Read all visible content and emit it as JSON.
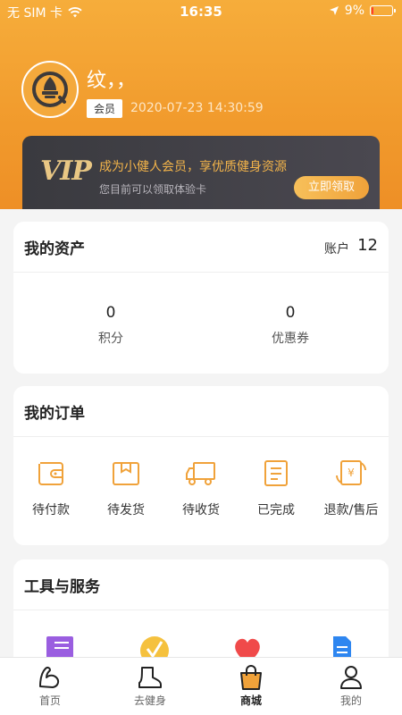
{
  "status_bar": {
    "carrier": "无 SIM 卡",
    "time": "16:35",
    "battery": "9%",
    "battery_level": 0.09
  },
  "profile": {
    "username": "纹，，",
    "member_badge": "会员",
    "login_time": "2020-07-23 14:30:59"
  },
  "vip": {
    "logo": "VIP",
    "title": "成为小健人会员，享优质健身资源",
    "subtitle": "您目前可以领取体验卡",
    "button": "立即领取"
  },
  "assets": {
    "title": "我的资产",
    "account_label": "账户",
    "account_value": "12",
    "items": [
      {
        "value": "0",
        "label": "积分"
      },
      {
        "value": "0",
        "label": "优惠券"
      }
    ]
  },
  "orders": {
    "title": "我的订单",
    "items": [
      {
        "label": "待付款",
        "icon": "wallet-icon"
      },
      {
        "label": "待发货",
        "icon": "package-icon"
      },
      {
        "label": "待收货",
        "icon": "truck-icon"
      },
      {
        "label": "已完成",
        "icon": "document-icon"
      },
      {
        "label": "退款/售后",
        "icon": "refund-icon"
      }
    ]
  },
  "tools": {
    "title": "工具与服务",
    "icons": [
      "notebook-icon",
      "check-badge-icon",
      "heart-icon",
      "file-icon"
    ]
  },
  "tabbar": {
    "items": [
      {
        "label": "首页",
        "icon": "arm-muscle-icon"
      },
      {
        "label": "去健身",
        "icon": "shoe-icon"
      },
      {
        "label": "商城",
        "icon": "shopping-bag-icon",
        "active": true
      },
      {
        "label": "我的",
        "icon": "person-icon"
      }
    ]
  },
  "colors": {
    "accent": "#f0a23a",
    "header": "#f4a23a",
    "vip_card": "#3a3a3f"
  }
}
